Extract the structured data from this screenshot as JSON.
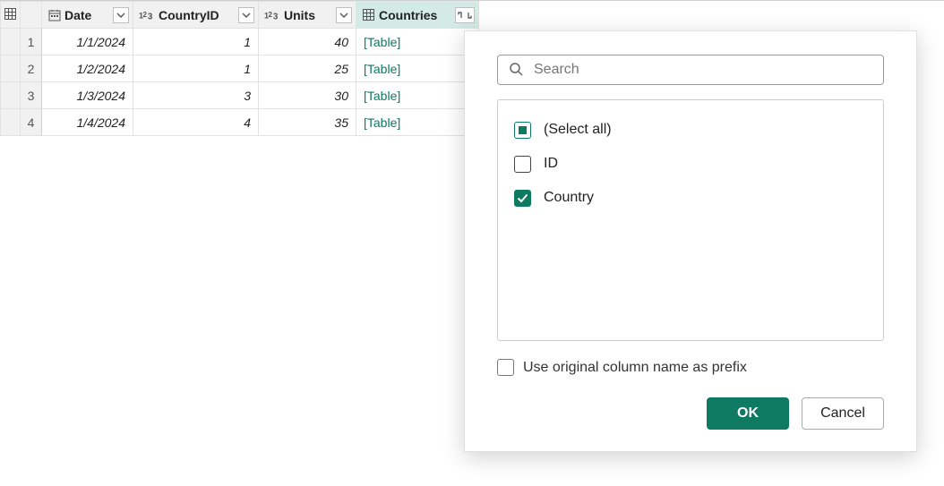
{
  "table": {
    "columns": {
      "date": "Date",
      "countryid": "CountryID",
      "units": "Units",
      "countries": "Countries"
    },
    "rows": [
      {
        "n": "1",
        "date": "1/1/2024",
        "countryid": "1",
        "units": "40",
        "countries": "[Table]"
      },
      {
        "n": "2",
        "date": "1/2/2024",
        "countryid": "1",
        "units": "25",
        "countries": "[Table]"
      },
      {
        "n": "3",
        "date": "1/3/2024",
        "countryid": "3",
        "units": "30",
        "countries": "[Table]"
      },
      {
        "n": "4",
        "date": "1/4/2024",
        "countryid": "4",
        "units": "35",
        "countries": "[Table]"
      }
    ]
  },
  "popup": {
    "search_placeholder": "Search",
    "items": {
      "select_all": "(Select all)",
      "id": "ID",
      "country": "Country"
    },
    "prefix_label": "Use original column name as prefix",
    "ok": "OK",
    "cancel": "Cancel"
  }
}
